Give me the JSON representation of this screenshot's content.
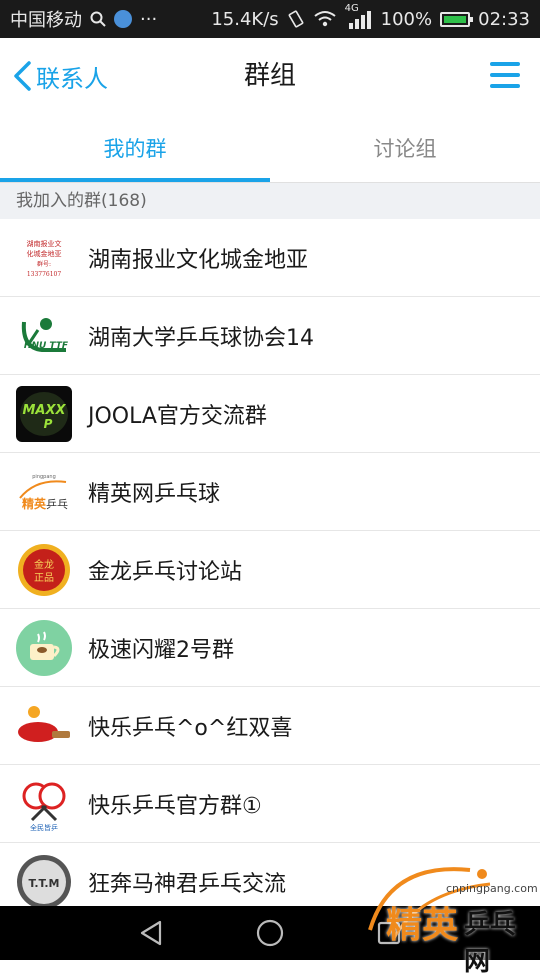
{
  "status_bar": {
    "carrier": "中国移动",
    "speed": "15.4K/s",
    "network": "4G",
    "battery": "100%",
    "time": "02:33"
  },
  "header": {
    "back_label": "联系人",
    "title": "群组"
  },
  "tabs": [
    {
      "label": "我的群",
      "active": true
    },
    {
      "label": "讨论组",
      "active": false
    }
  ],
  "section_header": "我加入的群(168)",
  "groups": [
    {
      "name": "湖南报业文化城金地亚",
      "avatar_text": "湖南报业文化城金地亚 群号: 133776107",
      "avatar": "newspaper-logo"
    },
    {
      "name": "湖南大学乒乓球协会14",
      "avatar_text": "HNU TTF",
      "avatar": "hnu-ttf-logo"
    },
    {
      "name": "JOOLA官方交流群",
      "avatar_text": "MAXXX P",
      "avatar": "joola-logo"
    },
    {
      "name": "精英网乒乓球",
      "avatar_text": "精英乒乓 pingpang",
      "avatar": "cnpingpang-logo"
    },
    {
      "name": "金龙乒乓讨论站",
      "avatar_text": "金龙正品",
      "avatar": "jinlong-logo"
    },
    {
      "name": "极速闪耀2号群",
      "avatar_text": "",
      "avatar": "coffee-cup-icon"
    },
    {
      "name": "快乐乒乓^o^红双喜",
      "avatar_text": "",
      "avatar": "paddle-icon"
    },
    {
      "name": "快乐乒乓官方群①",
      "avatar_text": "全民皆乒",
      "avatar": "crossed-paddles-logo"
    },
    {
      "name": "狂奔马神君乒乓交流",
      "avatar_text": "T.T.M",
      "avatar": "ttm-logo"
    }
  ],
  "watermark": {
    "domain": "cnpingpang.com",
    "brand_a": "精英",
    "brand_b": "乒乓网"
  },
  "colors": {
    "accent": "#1aa3e8",
    "section_bg": "#eff1f4"
  }
}
